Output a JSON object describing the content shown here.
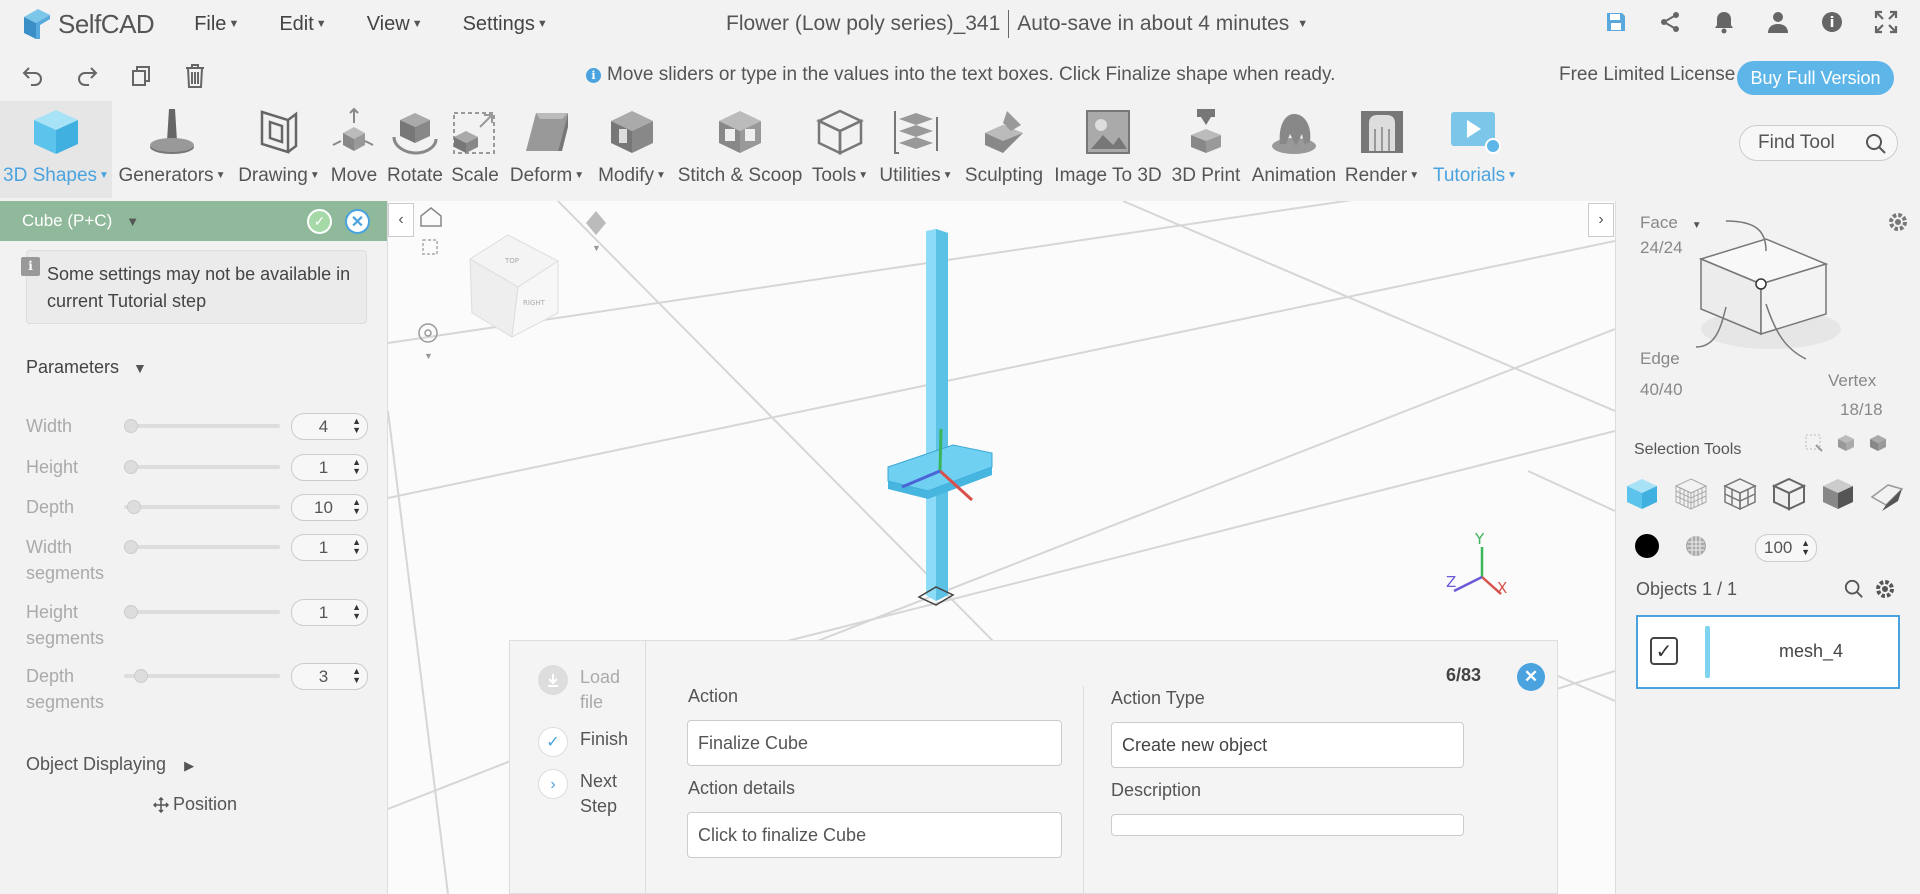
{
  "app": {
    "logo_text": "SelfCAD",
    "doc_title": "Flower (Low poly series)_341",
    "autosave": "Auto-save in about 4 minutes"
  },
  "menu": {
    "file": "File",
    "edit": "Edit",
    "view": "View",
    "settings": "Settings"
  },
  "hint_bar": {
    "hint": "Move sliders or type in the values into the text boxes. Click Finalize shape when ready.",
    "license": "Free Limited License",
    "buy": "Buy Full Version"
  },
  "toolbar": {
    "tools": [
      {
        "label": "3D Shapes",
        "dropdown": true
      },
      {
        "label": "Generators",
        "dropdown": true
      },
      {
        "label": "Drawing",
        "dropdown": true
      },
      {
        "label": "Move",
        "dropdown": false
      },
      {
        "label": "Rotate",
        "dropdown": false
      },
      {
        "label": "Scale",
        "dropdown": false
      },
      {
        "label": "Deform",
        "dropdown": true
      },
      {
        "label": "Modify",
        "dropdown": true
      },
      {
        "label": "Stitch & Scoop",
        "dropdown": false
      },
      {
        "label": "Tools",
        "dropdown": true
      },
      {
        "label": "Utilities",
        "dropdown": true
      },
      {
        "label": "Sculpting",
        "dropdown": false
      },
      {
        "label": "Image To 3D",
        "dropdown": false
      },
      {
        "label": "3D Print",
        "dropdown": false
      },
      {
        "label": "Animation",
        "dropdown": false
      },
      {
        "label": "Render",
        "dropdown": true
      },
      {
        "label": "Tutorials",
        "dropdown": true
      }
    ],
    "find_tool": "Find Tool"
  },
  "left_panel": {
    "title": "Cube (P+C)",
    "notice": "Some settings may not be available in current Tutorial step",
    "parameters_title": "Parameters",
    "params": [
      {
        "label": "Width",
        "value": "4",
        "slider": 0.0
      },
      {
        "label": "Height",
        "value": "1",
        "slider": 0.0
      },
      {
        "label": "Depth",
        "value": "10",
        "slider": 0.02
      },
      {
        "label": "Width segments",
        "value": "1",
        "slider": 0.0
      },
      {
        "label": "Height segments",
        "value": "1",
        "slider": 0.0
      },
      {
        "label": "Depth segments",
        "value": "3",
        "slider": 0.07
      }
    ],
    "object_displaying": "Object Displaying",
    "position": "Position"
  },
  "tutorial": {
    "steps": [
      "Load file",
      "Finish",
      "Next Step"
    ],
    "counter": "6/83",
    "action_label": "Action",
    "action_value": "Finalize Cube",
    "action_details_label": "Action details",
    "action_details_value": "Click to finalize Cube",
    "action_type_label": "Action Type",
    "action_type_value": "Create new object",
    "description_label": "Description",
    "description_value": ""
  },
  "right_panel": {
    "face_label": "Face",
    "face_count": "24/24",
    "edge_label": "Edge",
    "edge_count": "40/40",
    "vertex_label": "Vertex",
    "vertex_count": "18/18",
    "selection_tools": "Selection Tools",
    "opacity": "100",
    "objects_label": "Objects 1 / 1",
    "object_name": "mesh_4"
  },
  "viewport": {
    "axis_x": "X",
    "axis_y": "Y",
    "axis_z": "Z",
    "cube_top": "TOP",
    "cube_right": "RIGHT"
  },
  "colors": {
    "accent": "#4aa3df",
    "header_green": "#8fb99a",
    "shape_blue": "#6fd0f2"
  }
}
